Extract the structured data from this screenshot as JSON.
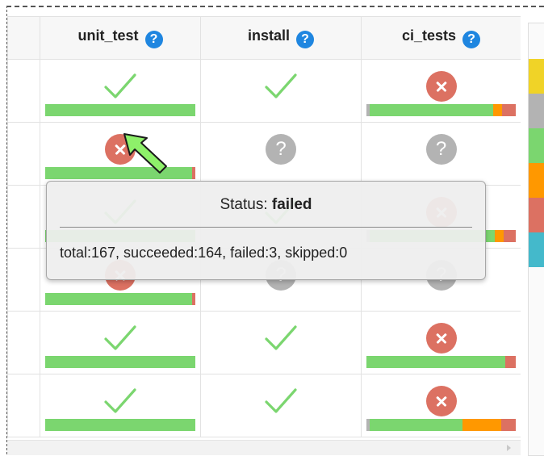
{
  "columns": [
    {
      "label": "unit_test",
      "help": "?"
    },
    {
      "label": "install",
      "help": "?"
    },
    {
      "label": "ci_tests",
      "help": "?"
    }
  ],
  "status_colors": {
    "success": "#7bd66f",
    "failure": "#dc7162",
    "skipped": "#b3b3b3",
    "unknown": "#ff9800",
    "pending": "#f0d327",
    "cancelled": "#44b9cb"
  },
  "rows": [
    {
      "cells": [
        {
          "status": "success",
          "bar": [
            {
              "c": "success",
              "f": 1.0
            }
          ]
        },
        {
          "status": "success",
          "bar": []
        },
        {
          "status": "failure",
          "bar": [
            {
              "c": "skipped",
              "f": 0.02
            },
            {
              "c": "success",
              "f": 0.83
            },
            {
              "c": "unknown",
              "f": 0.06
            },
            {
              "c": "failure",
              "f": 0.09
            }
          ]
        }
      ]
    },
    {
      "cells": [
        {
          "status": "failure",
          "bar": [
            {
              "c": "success",
              "f": 0.98
            },
            {
              "c": "failure",
              "f": 0.02
            }
          ]
        },
        {
          "status": "unknown",
          "bar": []
        },
        {
          "status": "unknown",
          "bar": []
        }
      ]
    },
    {
      "cells": [
        {
          "status": "success",
          "bar": [
            {
              "c": "success",
              "f": 1.0
            }
          ]
        },
        {
          "status": "success",
          "bar": []
        },
        {
          "status": "failure",
          "bar": [
            {
              "c": "skipped",
              "f": 0.02
            },
            {
              "c": "success",
              "f": 0.84
            },
            {
              "c": "unknown",
              "f": 0.06
            },
            {
              "c": "failure",
              "f": 0.08
            }
          ]
        }
      ]
    },
    {
      "cells": [
        {
          "status": "failure",
          "bar": [
            {
              "c": "success",
              "f": 0.98
            },
            {
              "c": "failure",
              "f": 0.02
            }
          ]
        },
        {
          "status": "unknown",
          "bar": []
        },
        {
          "status": "unknown",
          "bar": []
        }
      ]
    },
    {
      "cells": [
        {
          "status": "success",
          "bar": [
            {
              "c": "success",
              "f": 1.0
            }
          ]
        },
        {
          "status": "success",
          "bar": []
        },
        {
          "status": "failure",
          "bar": [
            {
              "c": "success",
              "f": 0.93
            },
            {
              "c": "failure",
              "f": 0.07
            }
          ]
        }
      ]
    },
    {
      "cells": [
        {
          "status": "success",
          "bar": [
            {
              "c": "success",
              "f": 1.0
            }
          ]
        },
        {
          "status": "success",
          "bar": []
        },
        {
          "status": "failure",
          "bar": [
            {
              "c": "skipped",
              "f": 0.02
            },
            {
              "c": "success",
              "f": 0.65
            },
            {
              "c": "unknown",
              "f": 0.27
            },
            {
              "c": "failure",
              "f": 0.1
            }
          ]
        }
      ]
    }
  ],
  "legend_colors": [
    "#f0d327",
    "#b3b3b3",
    "#7bd66f",
    "#ff9800",
    "#dc7162",
    "#44b9cb"
  ],
  "tooltip": {
    "title_prefix": "Status:",
    "title_value": "failed",
    "body": "total:167, succeeded:164, failed:3, skipped:0"
  }
}
